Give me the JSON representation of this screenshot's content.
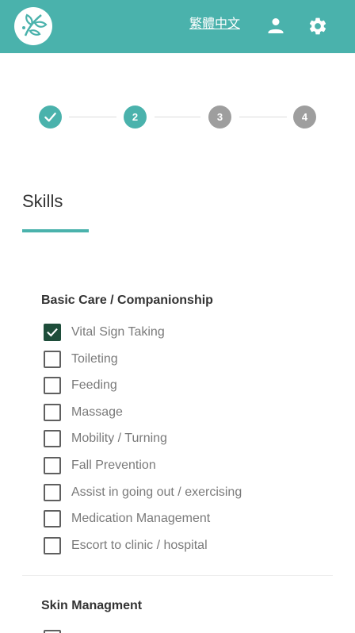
{
  "header": {
    "language_link": "繁體中文",
    "accent_color": "#4ab2ac"
  },
  "stepper": {
    "steps": [
      {
        "label": "",
        "state": "done"
      },
      {
        "label": "2",
        "state": "active"
      },
      {
        "label": "3",
        "state": "todo"
      },
      {
        "label": "4",
        "state": "todo"
      }
    ]
  },
  "page": {
    "title": "Skills"
  },
  "groups": [
    {
      "title": "Basic Care / Companionship",
      "items": [
        {
          "label": "Vital Sign Taking",
          "checked": true
        },
        {
          "label": "Toileting",
          "checked": false
        },
        {
          "label": "Feeding",
          "checked": false
        },
        {
          "label": "Massage",
          "checked": false
        },
        {
          "label": "Mobility / Turning",
          "checked": false
        },
        {
          "label": "Fall Prevention",
          "checked": false
        },
        {
          "label": "Assist in going out / exercising",
          "checked": false
        },
        {
          "label": "Medication Management",
          "checked": false
        },
        {
          "label": "Escort to clinic / hospital",
          "checked": false
        }
      ]
    },
    {
      "title": "Skin Managment",
      "items": [
        {
          "label": "",
          "checked": false
        }
      ]
    }
  ]
}
